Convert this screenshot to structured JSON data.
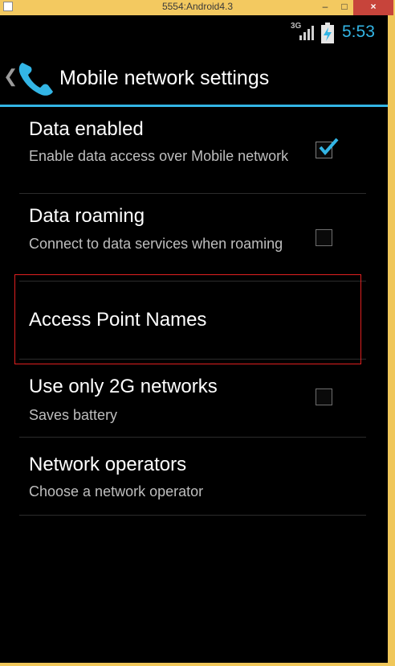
{
  "window": {
    "title": "5554:Android4.3",
    "minimize_glyph": "–",
    "maximize_glyph": "□",
    "close_glyph": "×"
  },
  "status_bar": {
    "network_type": "3G",
    "time": "5:53",
    "accent_color": "#33b5e5"
  },
  "action_bar": {
    "back_glyph": "❮",
    "icon": "phone-icon",
    "title": "Mobile network settings"
  },
  "preferences": [
    {
      "title": "Data enabled",
      "summary": "Enable data access over Mobile network",
      "has_checkbox": true,
      "checked": true
    },
    {
      "title": "Data roaming",
      "summary": "Connect to data services when roaming",
      "has_checkbox": true,
      "checked": false
    },
    {
      "title": "Access Point Names",
      "summary": "",
      "has_checkbox": false,
      "checked": false,
      "highlighted": true
    },
    {
      "title": "Use only 2G networks",
      "summary": "Saves battery",
      "has_checkbox": true,
      "checked": false
    },
    {
      "title": "Network operators",
      "summary": "Choose a network operator",
      "has_checkbox": false,
      "checked": false
    }
  ]
}
